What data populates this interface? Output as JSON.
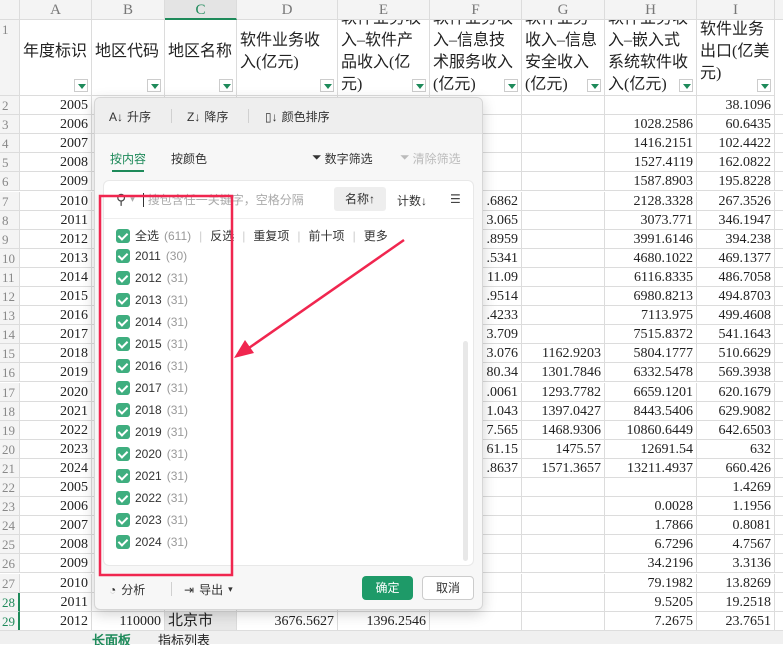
{
  "columns": [
    "A",
    "B",
    "C",
    "D",
    "E",
    "F",
    "G",
    "H",
    "I"
  ],
  "selected_column": "C",
  "headers": [
    "年度标识",
    "地区代码",
    "地区名称",
    "软件业务收入(亿元)",
    "软件业务收入–软件产品收入(亿元)",
    "软件业务收入–信息技术服务收入(亿元)",
    "软件业务收入–信息安全收入(亿元)",
    "软件业务收入–嵌入式系统软件收入(亿元)",
    "软件业务出口(亿美元)"
  ],
  "rows": [
    [
      "2",
      "2005",
      "",
      "",
      "",
      "",
      "",
      "",
      "",
      "38.1096"
    ],
    [
      "3",
      "2006",
      "",
      "",
      "",
      "",
      "",
      "",
      "1028.2586",
      "60.6435"
    ],
    [
      "4",
      "2007",
      "",
      "",
      "",
      "",
      "",
      "",
      "1416.2151",
      "102.4422"
    ],
    [
      "5",
      "2008",
      "",
      "",
      "",
      "",
      "",
      "",
      "1527.4119",
      "162.0822"
    ],
    [
      "6",
      "2009",
      "",
      "",
      "",
      "",
      "",
      "",
      "1587.8903",
      "195.8228"
    ],
    [
      "7",
      "2010",
      "",
      "",
      "",
      "",
      ".6862",
      "",
      "2128.3328",
      "267.3526"
    ],
    [
      "8",
      "2011",
      "",
      "",
      "",
      "",
      "3.065",
      "",
      "3073.771",
      "346.1947"
    ],
    [
      "9",
      "2012",
      "",
      "",
      "",
      "",
      ".8959",
      "",
      "3991.6146",
      "394.238"
    ],
    [
      "10",
      "2013",
      "",
      "",
      "",
      "",
      ".5341",
      "",
      "4680.1022",
      "469.1377"
    ],
    [
      "11",
      "2014",
      "",
      "",
      "",
      "",
      "11.09",
      "",
      "6116.8335",
      "486.7058"
    ],
    [
      "12",
      "2015",
      "",
      "",
      "",
      "",
      ".9514",
      "",
      "6980.8213",
      "494.8703"
    ],
    [
      "13",
      "2016",
      "",
      "",
      "",
      "",
      ".4233",
      "",
      "7113.975",
      "499.4608"
    ],
    [
      "14",
      "2017",
      "",
      "",
      "",
      "",
      "3.709",
      "",
      "7515.8372",
      "541.1643"
    ],
    [
      "15",
      "2018",
      "",
      "",
      "",
      "",
      "3.076",
      "1162.9203",
      "5804.1777",
      "510.6629"
    ],
    [
      "16",
      "2019",
      "",
      "",
      "",
      "",
      "80.34",
      "1301.7846",
      "6332.5478",
      "569.3938"
    ],
    [
      "17",
      "2020",
      "",
      "",
      "",
      "",
      ".0061",
      "1293.7782",
      "6659.1201",
      "620.1679"
    ],
    [
      "18",
      "2021",
      "",
      "",
      "",
      "",
      "1.043",
      "1397.0427",
      "8443.5406",
      "629.9082"
    ],
    [
      "19",
      "2022",
      "",
      "",
      "",
      "",
      "7.565",
      "1468.9306",
      "10860.6449",
      "642.6503"
    ],
    [
      "20",
      "2023",
      "",
      "",
      "",
      "",
      "61.15",
      "1475.57",
      "12691.54",
      "632"
    ],
    [
      "21",
      "2024",
      "",
      "",
      "",
      "",
      ".8637",
      "1571.3657",
      "13211.4937",
      "660.426"
    ],
    [
      "22",
      "2005",
      "",
      "",
      "",
      "",
      "",
      "",
      "",
      "1.4269"
    ],
    [
      "23",
      "2006",
      "",
      "",
      "",
      "",
      "",
      "",
      "0.0028",
      "1.1956"
    ],
    [
      "24",
      "2007",
      "",
      "",
      "",
      "",
      "",
      "",
      "1.7866",
      "0.8081"
    ],
    [
      "25",
      "2008",
      "",
      "",
      "",
      "",
      "",
      "",
      "6.7296",
      "4.7567"
    ],
    [
      "26",
      "2009",
      "",
      "",
      "",
      "",
      "",
      "",
      "34.2196",
      "3.3136"
    ],
    [
      "27",
      "2010",
      "",
      "",
      "",
      "",
      "",
      "",
      "79.1982",
      "13.8269"
    ],
    [
      "28",
      "2011",
      "",
      "",
      "",
      "",
      "",
      "",
      "9.5205",
      "19.2518"
    ],
    [
      "29",
      "2012",
      "110000",
      "北京市",
      "3676.5627",
      "1396.2546",
      "",
      "",
      "7.2675",
      "23.7651"
    ]
  ],
  "sheet_tabs": [
    "长面板",
    "指标列表"
  ],
  "filter": {
    "sort": {
      "asc": "升序",
      "desc": "降序",
      "color": "颜色排序"
    },
    "tabs": {
      "content": "按内容",
      "color": "按颜色"
    },
    "number_filter": "数字筛选",
    "clear_filter": "清除筛选",
    "search_placeholder": "搜包含任一关键字，空格分隔",
    "name_sort": "名称↑",
    "count_sort": "计数↓",
    "select_all": "全选",
    "select_all_count": "(611)",
    "options": [
      "反选",
      "重复项",
      "前十项",
      "更多"
    ],
    "items": [
      {
        "label": "2011",
        "count": "(30)"
      },
      {
        "label": "2012",
        "count": "(31)"
      },
      {
        "label": "2013",
        "count": "(31)"
      },
      {
        "label": "2014",
        "count": "(31)"
      },
      {
        "label": "2015",
        "count": "(31)"
      },
      {
        "label": "2016",
        "count": "(31)"
      },
      {
        "label": "2017",
        "count": "(31)"
      },
      {
        "label": "2018",
        "count": "(31)"
      },
      {
        "label": "2019",
        "count": "(31)"
      },
      {
        "label": "2020",
        "count": "(31)"
      },
      {
        "label": "2021",
        "count": "(31)"
      },
      {
        "label": "2022",
        "count": "(31)"
      },
      {
        "label": "2023",
        "count": "(31)"
      },
      {
        "label": "2024",
        "count": "(31)"
      }
    ],
    "analyze": "分析",
    "export": "导出",
    "ok": "确定",
    "cancel": "取消"
  },
  "colors": {
    "accent": "#1e9a68",
    "annotation": "#f0264f"
  }
}
